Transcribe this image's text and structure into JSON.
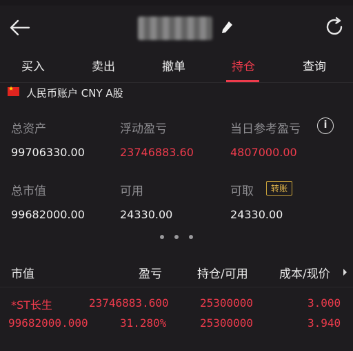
{
  "tabs": [
    "买入",
    "卖出",
    "撤单",
    "持仓",
    "查询"
  ],
  "active_tab": "持仓",
  "account": {
    "label": "人民币账户 CNY A股"
  },
  "summary": {
    "total_assets_label": "总资产",
    "total_assets": "99706330.00",
    "floating_pl_label": "浮动盈亏",
    "floating_pl": "23746883.60",
    "today_pl_label": "当日参考盈亏",
    "today_pl": "4807000.00",
    "market_value_label": "总市值",
    "market_value": "99682000.00",
    "available_label": "可用",
    "available": "24330.00",
    "withdrawable_label": "可取",
    "withdrawable": "24330.00",
    "transfer_label": "转账"
  },
  "table": {
    "headers": [
      "市值",
      "盈亏",
      "持仓/可用",
      "成本/现价"
    ],
    "rows": [
      {
        "c1": "*ST长生",
        "c2": "23746883.600",
        "c3": "25300000",
        "c4": "3.000"
      },
      {
        "c1": "99682000.000",
        "c2": "31.280%",
        "c3": "25300000",
        "c4": "3.940"
      }
    ]
  },
  "colors": {
    "accent_red": "#ee3b4c",
    "background": "#1e1c1f",
    "gold": "#e2b64b"
  },
  "icons": [
    "back-arrow-icon",
    "edit-icon",
    "refresh-icon",
    "info-icon",
    "china-flag-icon"
  ]
}
